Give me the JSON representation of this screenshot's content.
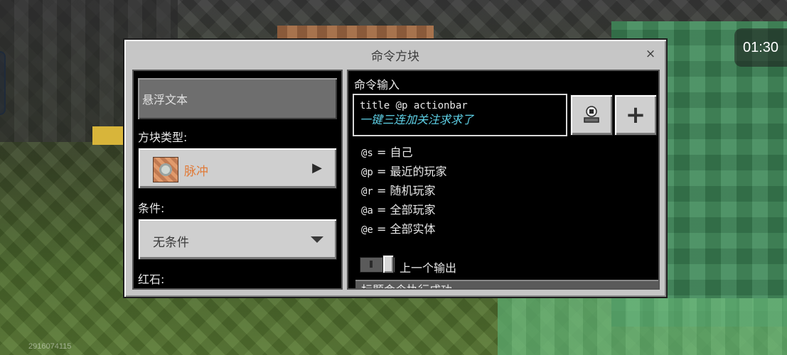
{
  "dialog": {
    "title": "命令方块",
    "close_label": "×"
  },
  "left": {
    "hover_text_placeholder": "悬浮文本",
    "block_type_label": "方块类型:",
    "block_type_value": "脉冲",
    "condition_label": "条件:",
    "condition_value": "无条件",
    "redstone_label": "红石:"
  },
  "right": {
    "command_input_label": "命令输入",
    "command_line1": "title @p actionbar",
    "command_line2": "一键三连加关注求求了",
    "add_button_label": "+",
    "selectors": [
      {
        "selector": "@s",
        "desc": "= 自己"
      },
      {
        "selector": "@p",
        "desc": "= 最近的玩家"
      },
      {
        "selector": "@r",
        "desc": "= 随机玩家"
      },
      {
        "selector": "@a",
        "desc": "= 全部玩家"
      },
      {
        "selector": "@e",
        "desc": "= 全部实体"
      }
    ],
    "previous_output_label": "上一个输出",
    "previous_output_text": "标题命令执行成功"
  },
  "hud": {
    "time": "01:30",
    "watermark": "2916074115"
  },
  "icons": {
    "close": "close-icon",
    "block_type": "command-block-icon",
    "arrow": "chevron-right-icon",
    "caret": "caret-down-icon",
    "export": "export-output-icon",
    "add": "plus-icon"
  },
  "colors": {
    "accent_orange": "#e07b39",
    "command_cyan": "#5fd2e8"
  }
}
